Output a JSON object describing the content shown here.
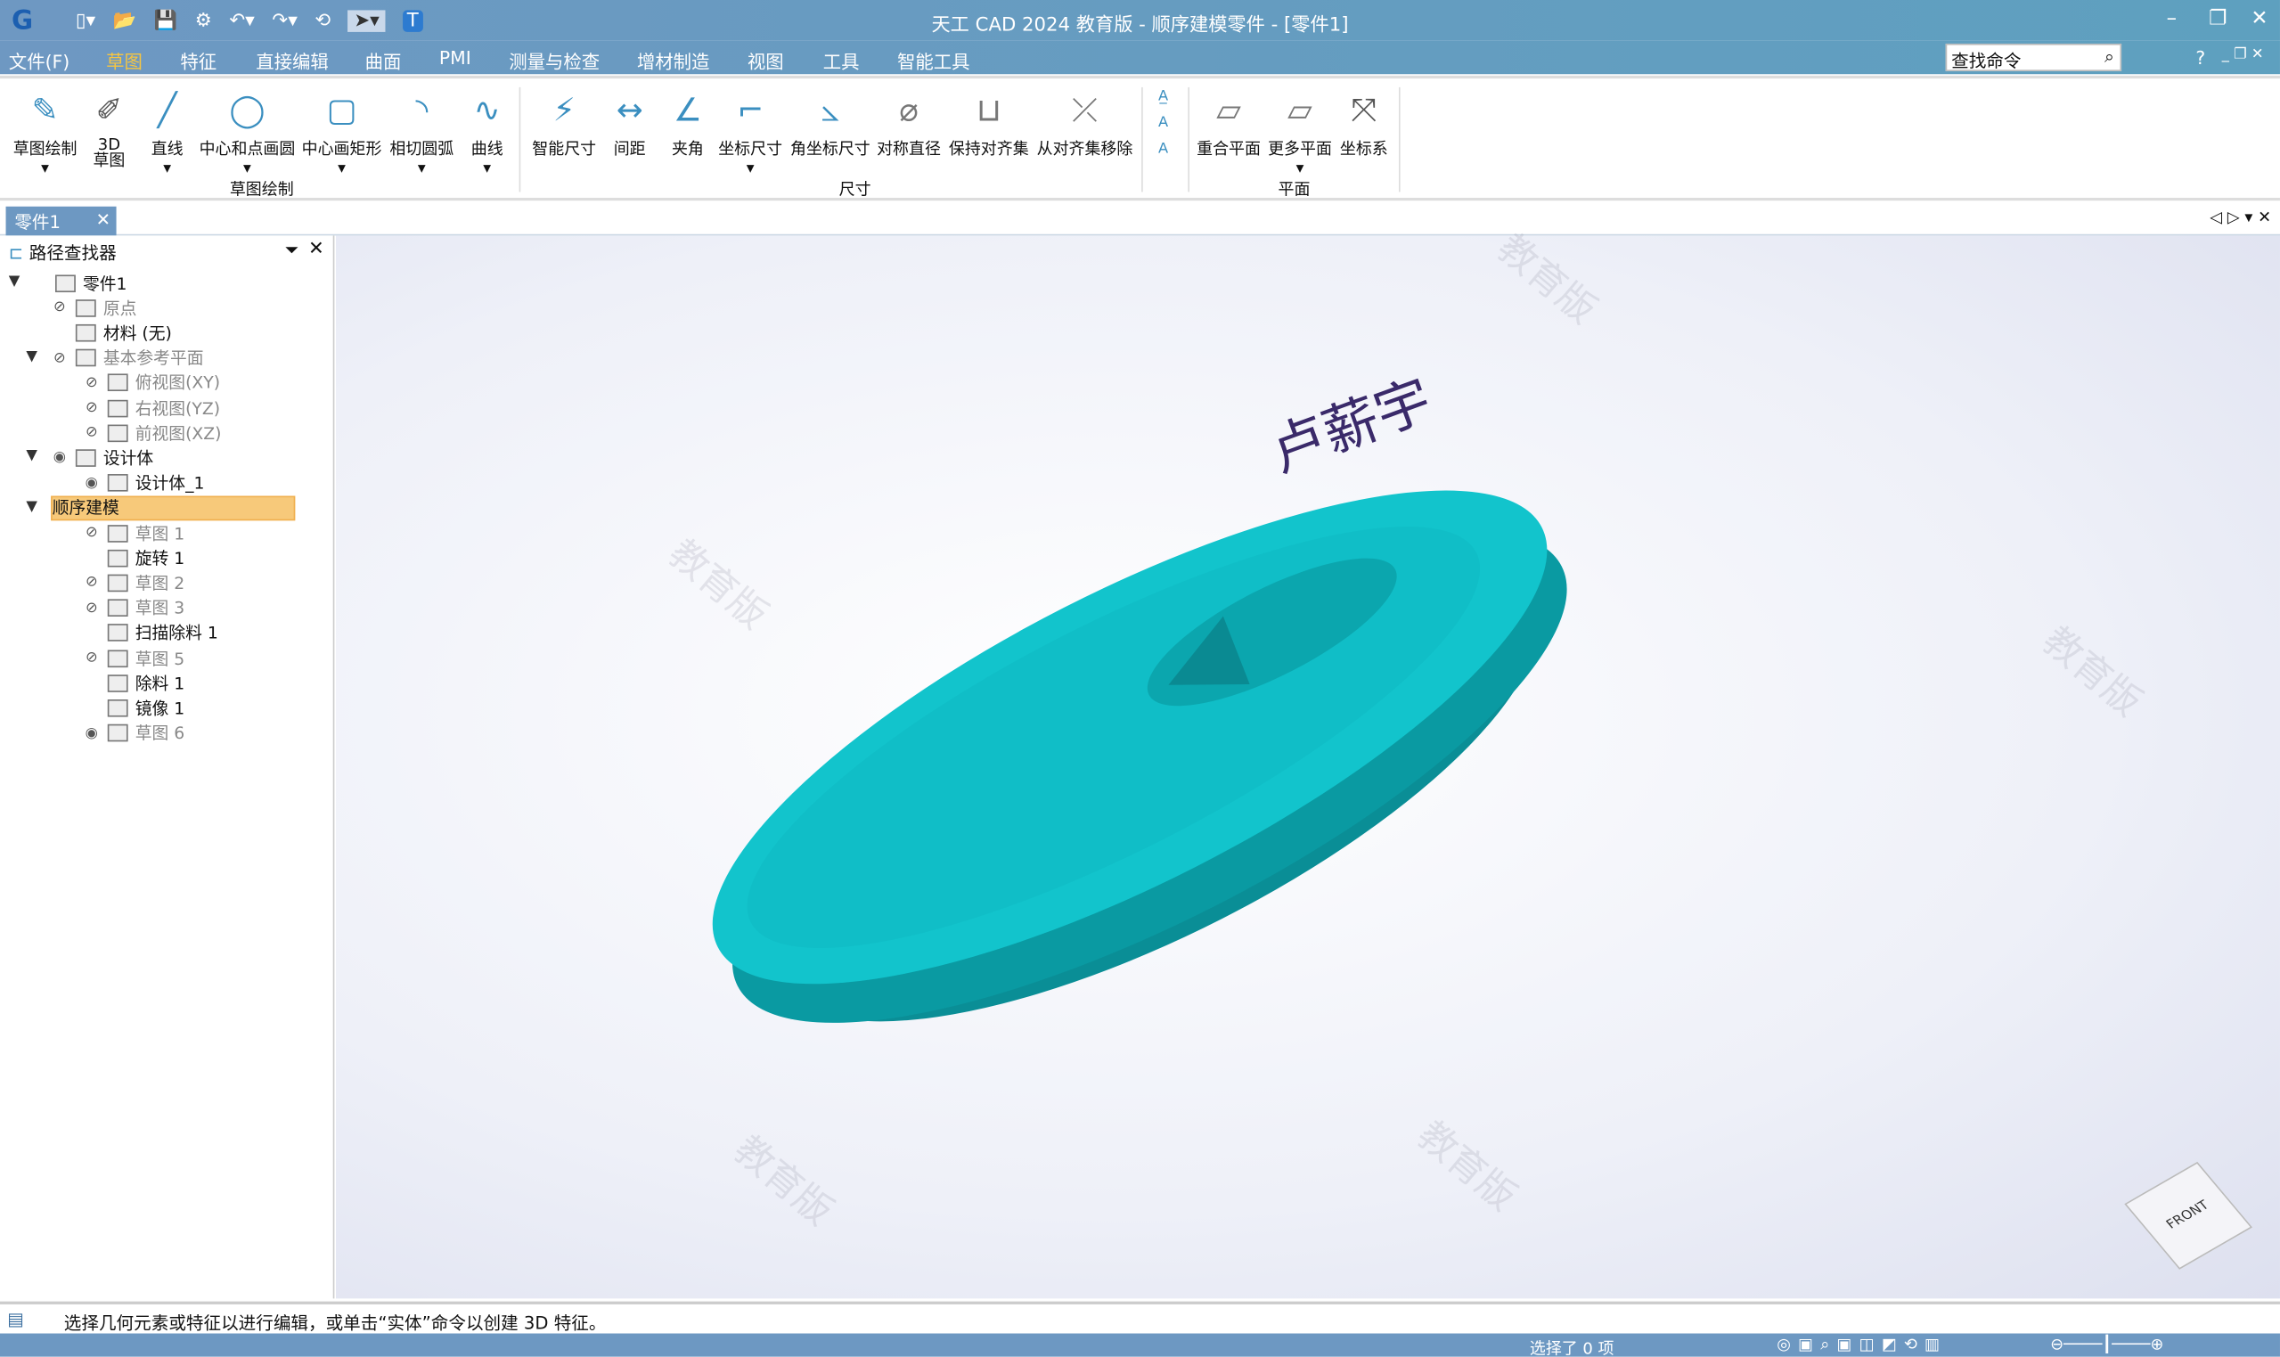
{
  "titlebar": {
    "title": "天工 CAD 2024 教育版 - 顺序建模零件 - [零件1]",
    "minimize": "–",
    "restore": "❐",
    "close": "✕"
  },
  "menu": {
    "items": [
      "文件(F)",
      "草图",
      "特征",
      "直接编辑",
      "曲面",
      "PMI",
      "测量与检查",
      "增材制造",
      "视图",
      "工具",
      "智能工具"
    ],
    "active": "草图",
    "search_placeholder": "查找命令",
    "help": "?"
  },
  "ribbon": {
    "sketch_tools": [
      "草图绘制",
      "3D\n草图",
      "直线",
      "中心和点画圆",
      "中心画矩形",
      "相切圆弧",
      "曲线"
    ],
    "sketch_group": "草图绘制",
    "dim_tools": [
      "智能尺寸",
      "间距",
      "夹角",
      "坐标尺寸",
      "角坐标尺寸",
      "对称直径",
      "保持对齐集",
      "从对齐集移除"
    ],
    "dim_group": "尺寸",
    "plane_tools": [
      "重合平面",
      "更多平面",
      "坐标系"
    ],
    "plane_group": "平面"
  },
  "doc_tab": {
    "label": "零件1",
    "close": "✕"
  },
  "pathfinder": {
    "title": "路径查找器",
    "items": [
      {
        "label": "零件1",
        "level": 0,
        "dim": false
      },
      {
        "label": "原点",
        "level": 1,
        "dim": true
      },
      {
        "label": "材料 (无)",
        "level": 1,
        "dim": false
      },
      {
        "label": "基本参考平面",
        "level": 1,
        "dim": true
      },
      {
        "label": "俯视图(XY)",
        "level": 2,
        "dim": true
      },
      {
        "label": "右视图(YZ)",
        "level": 2,
        "dim": true
      },
      {
        "label": "前视图(XZ)",
        "level": 2,
        "dim": true
      },
      {
        "label": "设计体",
        "level": 1,
        "dim": false
      },
      {
        "label": "设计体_1",
        "level": 2,
        "dim": false
      },
      {
        "label": "顺序建模",
        "level": 1,
        "dim": false,
        "selected": true
      },
      {
        "label": "草图 1",
        "level": 2,
        "dim": true
      },
      {
        "label": "旋转 1",
        "level": 2,
        "dim": false
      },
      {
        "label": "草图 2",
        "level": 2,
        "dim": true
      },
      {
        "label": "草图 3",
        "level": 2,
        "dim": true
      },
      {
        "label": "扫描除料 1",
        "level": 2,
        "dim": false
      },
      {
        "label": "草图 5",
        "level": 2,
        "dim": true
      },
      {
        "label": "除料 1",
        "level": 2,
        "dim": false
      },
      {
        "label": "镜像 1",
        "level": 2,
        "dim": false
      },
      {
        "label": "草图 6",
        "level": 2,
        "dim": true
      }
    ]
  },
  "viewport": {
    "watermark": "教育版",
    "signature": "卢薪宇",
    "view_cube": "FRONT",
    "part_color": "#0fc0c8"
  },
  "command_prompt": "选择几何元素或特征以进行编辑，或单击“实体”命令以创建 3D 特征。",
  "status": {
    "selection": "选择了 0 项"
  }
}
